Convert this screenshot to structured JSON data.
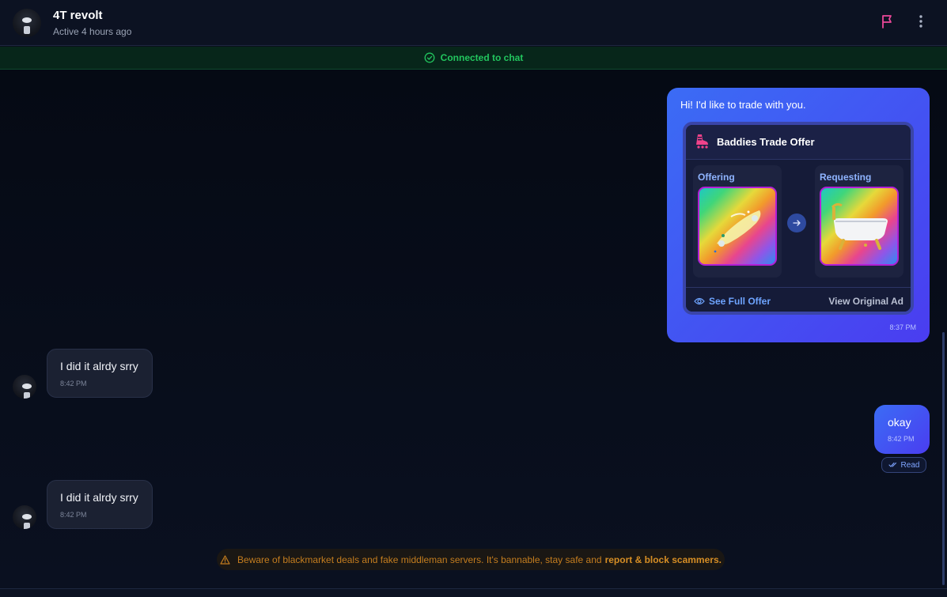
{
  "header": {
    "name": "4T revolt",
    "status": "Active 4 hours ago",
    "flag_icon": "flag-icon",
    "more_icon": "more-vertical-icon"
  },
  "connection": {
    "text": "Connected to chat",
    "color": "#22c55e"
  },
  "messages": [
    {
      "direction": "outgoing",
      "text": "Hi! I'd like to trade with you.",
      "time": "8:37 PM",
      "trade": {
        "title": "Baddies Trade Offer",
        "offering_label": "Offering",
        "requesting_label": "Requesting",
        "offering_item": "skateboard-item",
        "requesting_item": "bathtub-item",
        "see_full_label": "See Full Offer",
        "view_ad_label": "View Original Ad"
      }
    },
    {
      "direction": "incoming",
      "text": "I did it alrdy srry",
      "time": "8:42 PM"
    },
    {
      "direction": "outgoing",
      "text": "okay",
      "time": "8:42 PM",
      "receipt": "Read"
    },
    {
      "direction": "incoming",
      "text": "I did it alrdy srry",
      "time": "8:42 PM"
    }
  ],
  "warning": {
    "text": "Beware of blackmarket deals and fake middleman servers. It's bannable, stay safe and",
    "strong": "report & block scammers."
  },
  "colors": {
    "accent": "#4a5cf5",
    "warning": "#c47d1f",
    "flag": "#ec4899"
  }
}
